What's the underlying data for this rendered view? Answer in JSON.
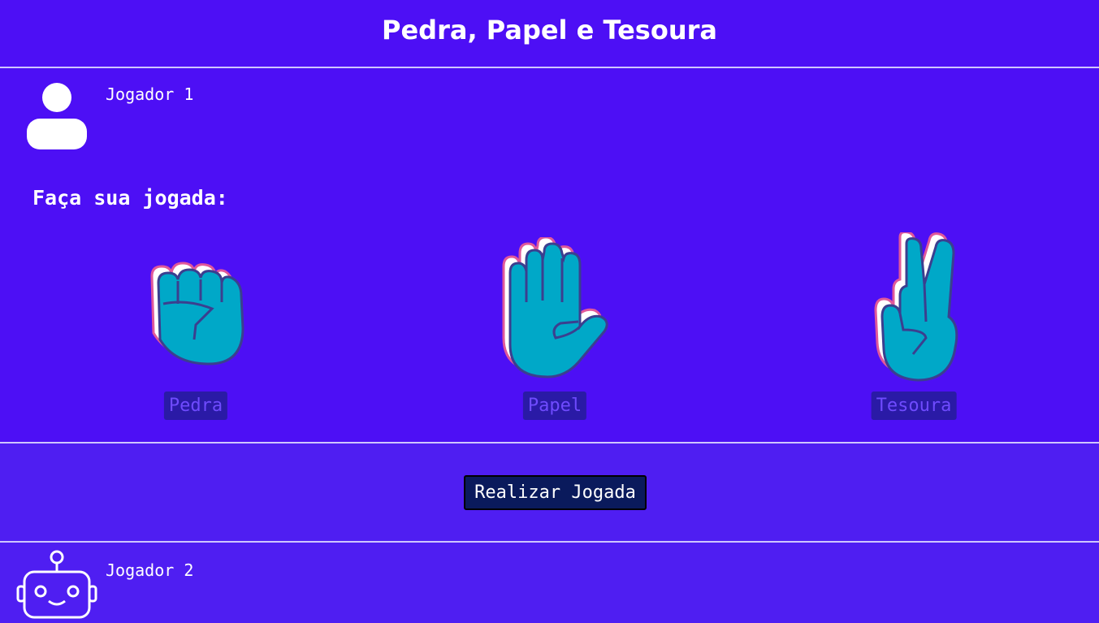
{
  "header": {
    "title": "Pedra, Papel e Tesoura"
  },
  "player1": {
    "name": "Jogador 1",
    "avatar_icon": "person-icon",
    "prompt": "Faça sua jogada:",
    "choices": [
      {
        "label": "Pedra",
        "icon": "rock-fist-icon"
      },
      {
        "label": "Papel",
        "icon": "paper-hand-icon"
      },
      {
        "label": "Tesoura",
        "icon": "scissors-hand-icon"
      }
    ]
  },
  "action": {
    "play_label": "Realizar Jogada"
  },
  "player2": {
    "name": "Jogador 2",
    "avatar_icon": "robot-icon"
  },
  "colors": {
    "background": "#4d0ff5",
    "hand_fill": "#00a8c8",
    "hand_outline": "#3b3f8f",
    "hand_shadow": "#e0589a",
    "button_bg": "#0a1a5c",
    "label_bg": "#2a1aa6",
    "label_text": "#6f4bff"
  }
}
